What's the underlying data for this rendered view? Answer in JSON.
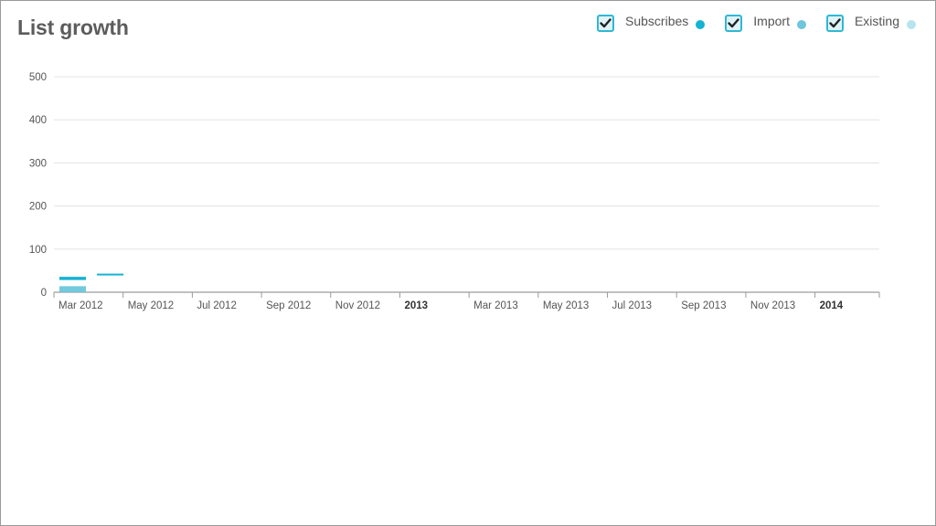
{
  "chart_data": {
    "type": "bar",
    "title": "List growth",
    "x_ticks": [
      "Mar 2012",
      "May 2012",
      "Jul 2012",
      "Sep 2012",
      "Nov 2012",
      "2013",
      "Mar 2013",
      "May 2013",
      "Jul 2013",
      "Sep 2013",
      "Nov 2013",
      "2014"
    ],
    "bold_ticks": [
      "2013",
      "2014"
    ],
    "y_ticks": [
      0,
      100,
      200,
      300,
      400,
      500
    ],
    "ylim": [
      0,
      500
    ],
    "xlim": [
      "2012-03",
      "2014-01"
    ],
    "grid": true,
    "legend_position": "top-right",
    "series": [
      {
        "name": "Subscribes",
        "color": "#15b2d3"
      },
      {
        "name": "Import",
        "color": "#6cc6dc"
      },
      {
        "name": "Existing",
        "color": "#b7e3ef"
      }
    ],
    "marks": [
      {
        "series": "Existing",
        "kind": "bar",
        "x_start": "2012-03",
        "x_end": "2012-04",
        "y_from": 0,
        "y_to": 14
      },
      {
        "series": "Subscribes",
        "kind": "line",
        "x_start": "2012-03",
        "x_end": "2012-04",
        "y": 32
      },
      {
        "series": "Subscribes",
        "kind": "line",
        "x_start": "2012-04",
        "x_end": "2012-05",
        "y": 41
      }
    ]
  }
}
